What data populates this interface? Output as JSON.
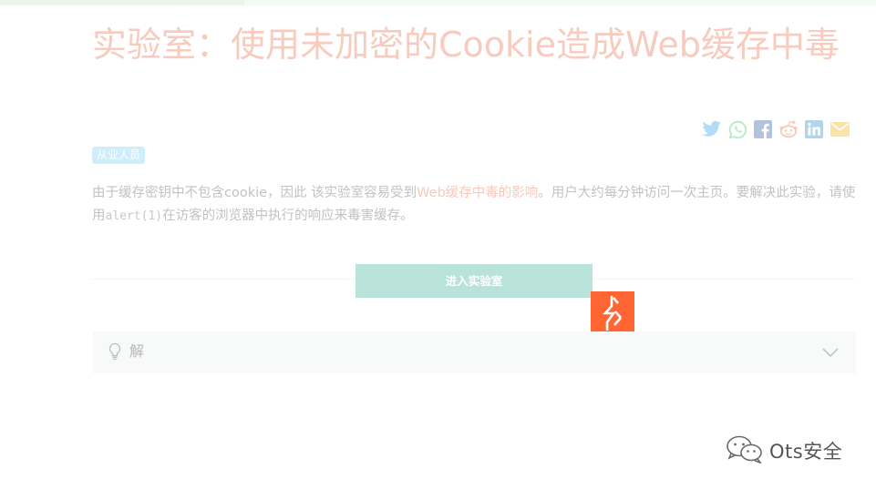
{
  "lab": {
    "title": "实验室：使用未加密的Cookie造成Web缓存中毒",
    "level_badge": "从业人员",
    "description": {
      "part1": "由于缓存密钥中不包含cookie，因此 该实验室容易受到",
      "link": "Web缓存中毒的影响",
      "part2": "。用户大约每分钟访问一次主页。要解决此实验，请使用",
      "code": "alert(1)",
      "part3": "在访客的浏览器中执行的响应来毒害缓存。"
    },
    "access_button_label": "进入实验室"
  },
  "share": {
    "icons": [
      "twitter-icon",
      "whatsapp-icon",
      "facebook-icon",
      "reddit-icon",
      "linkedin-icon",
      "email-icon"
    ],
    "colors": {
      "twitter": "#b3dcf6",
      "whatsapp": "#bfeac6",
      "facebook": "#b3c3de",
      "reddit": "#f7c9b7",
      "linkedin": "#b2d5ea",
      "email": "#fbe3a7"
    }
  },
  "solution": {
    "label": "解",
    "icon": "lightbulb-icon",
    "toggle_icon": "chevron-down-icon"
  },
  "watermark": {
    "text": "Ots安全",
    "icon": "wechat-icon"
  },
  "colors": {
    "title": "#f7cbbe",
    "button": "#b9e2d8",
    "badge": "#cdeefa",
    "burp": "#ff6633"
  }
}
